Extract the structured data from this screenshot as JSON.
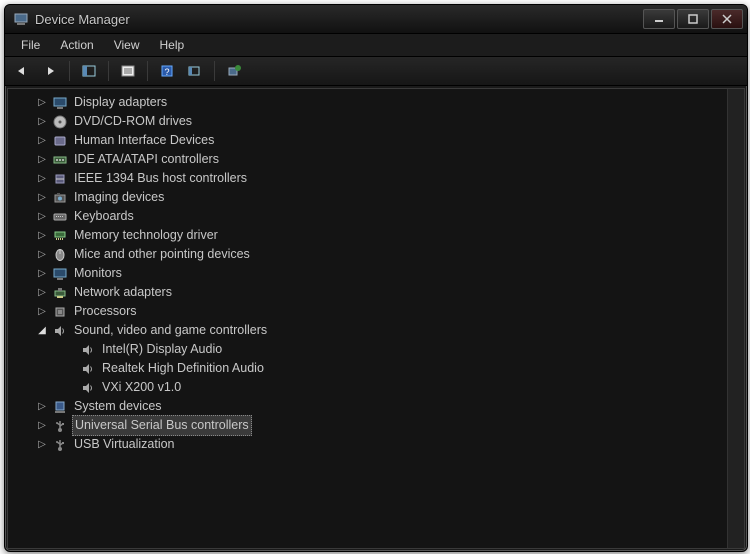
{
  "window": {
    "title": "Device Manager"
  },
  "menu": {
    "file": "File",
    "action": "Action",
    "view": "View",
    "help": "Help"
  },
  "tree": {
    "nodes": [
      {
        "label": "Display adapters",
        "icon": "monitor",
        "expanded": false,
        "hasChildren": true
      },
      {
        "label": "DVD/CD-ROM drives",
        "icon": "disc",
        "expanded": false,
        "hasChildren": true
      },
      {
        "label": "Human Interface Devices",
        "icon": "hid",
        "expanded": false,
        "hasChildren": true
      },
      {
        "label": "IDE ATA/ATAPI controllers",
        "icon": "ide",
        "expanded": false,
        "hasChildren": true
      },
      {
        "label": "IEEE 1394 Bus host controllers",
        "icon": "ieee",
        "expanded": false,
        "hasChildren": true
      },
      {
        "label": "Imaging devices",
        "icon": "camera",
        "expanded": false,
        "hasChildren": true
      },
      {
        "label": "Keyboards",
        "icon": "keyboard",
        "expanded": false,
        "hasChildren": true
      },
      {
        "label": "Memory technology driver",
        "icon": "memory",
        "expanded": false,
        "hasChildren": true
      },
      {
        "label": "Mice and other pointing devices",
        "icon": "mouse",
        "expanded": false,
        "hasChildren": true
      },
      {
        "label": "Monitors",
        "icon": "monitor",
        "expanded": false,
        "hasChildren": true
      },
      {
        "label": "Network adapters",
        "icon": "network",
        "expanded": false,
        "hasChildren": true
      },
      {
        "label": "Processors",
        "icon": "cpu",
        "expanded": false,
        "hasChildren": true
      },
      {
        "label": "Sound, video and game controllers",
        "icon": "sound",
        "expanded": true,
        "hasChildren": true,
        "children": [
          {
            "label": "Intel(R) Display Audio",
            "icon": "sound"
          },
          {
            "label": "Realtek High Definition Audio",
            "icon": "sound"
          },
          {
            "label": "VXi X200 v1.0",
            "icon": "sound"
          }
        ]
      },
      {
        "label": "System devices",
        "icon": "system",
        "expanded": false,
        "hasChildren": true
      },
      {
        "label": "Universal Serial Bus controllers",
        "icon": "usb",
        "expanded": false,
        "hasChildren": true,
        "selected": true
      },
      {
        "label": "USB Virtualization",
        "icon": "usb",
        "expanded": false,
        "hasChildren": true
      }
    ]
  }
}
